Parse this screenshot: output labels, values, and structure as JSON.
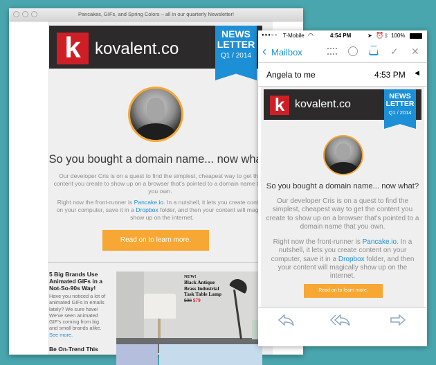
{
  "window": {
    "title": "Pancakes, GIFs, and Spring Colors – all in our quarterly Newsletter!"
  },
  "newsletter": {
    "logo_letter": "k",
    "brand": "kovalent.co",
    "ribbon_line1": "NEWS",
    "ribbon_line2": "LETTER",
    "ribbon_issue": "Q1 / 2014",
    "headline": "So you bought a domain name... now what?",
    "para1": "Our developer Cris is on a quest to find the simplest, cheapest way to get the content you create to show up on a browser that's pointed to a domain name that you own.",
    "para2_prefix": "Right now the front-runner is ",
    "para2_link": "Pancake.io",
    "para2_mid": ". In a nutshell, it lets you create content on your computer, save it in a ",
    "para2_link2": "Dropbox",
    "para2_suffix": " folder, and then your content will magically show up on the internet.",
    "cta": "Read on to learn more.",
    "desktop_para1_lines": [
      "Our developer Cris is on a quest to find the simplest, cheapest way to get the",
      "content you create to show up on a browser that's pointed to a domain name that",
      "you own."
    ],
    "desktop_para2_line1_prefix": "Right now the front-runner is ",
    "desktop_para2_line1_suffix": ". In a nutshell, it lets you create content",
    "desktop_para2_line2_prefix": "on your computer, save it in a ",
    "desktop_para2_line2_suffix": " folder, and then your content will magical",
    "desktop_para2_line3": "show up on the internet.",
    "article2": {
      "title_lines": [
        "5 Big Brands Use",
        "Animated GIFs in a",
        "Not-So-90s Way!"
      ],
      "body_lines": [
        "Have you noticed a lot of",
        "animated GIFs in emails",
        "lately? We sure have!",
        "We've seen animated",
        "GIF's coming from big",
        "and small brands alike."
      ],
      "see_more": "See more.",
      "promo_badge": "NEW!",
      "promo_lines": [
        "Black Antique",
        "Brass Industrial",
        "Task Table Lamp"
      ],
      "price_old": "$98",
      "price_new": "$79"
    },
    "article3_title": "Be On-Trend This"
  },
  "phone": {
    "carrier": "T-Mobile",
    "time": "4:54 PM",
    "battery": "100%",
    "back_label": "Mailbox",
    "from": "Angela to me",
    "received": "4:53 PM",
    "para1_lines": [
      "Our developer Cris is on a quest to find the",
      "simplest, cheapest way to get the content you",
      "create to show up on a browser that's pointed to a",
      "domain name that you own."
    ],
    "para2_line1_prefix": "Right now the front-runner is ",
    "para2_line1_suffix": ". In a",
    "para2_line2": "nutshell, it lets you create content on your",
    "para2_line3_prefix": "computer, save it in a ",
    "para2_line3_suffix": " folder, and then",
    "para2_line4": "your content will magically show up on the",
    "para2_line5": "internet."
  },
  "colors": {
    "background": "#4aa6ae",
    "brand_red": "#cf1f26",
    "brand_blue": "#1c8fd7",
    "cta_orange": "#f7a733",
    "ios_blue": "#2196d8"
  }
}
